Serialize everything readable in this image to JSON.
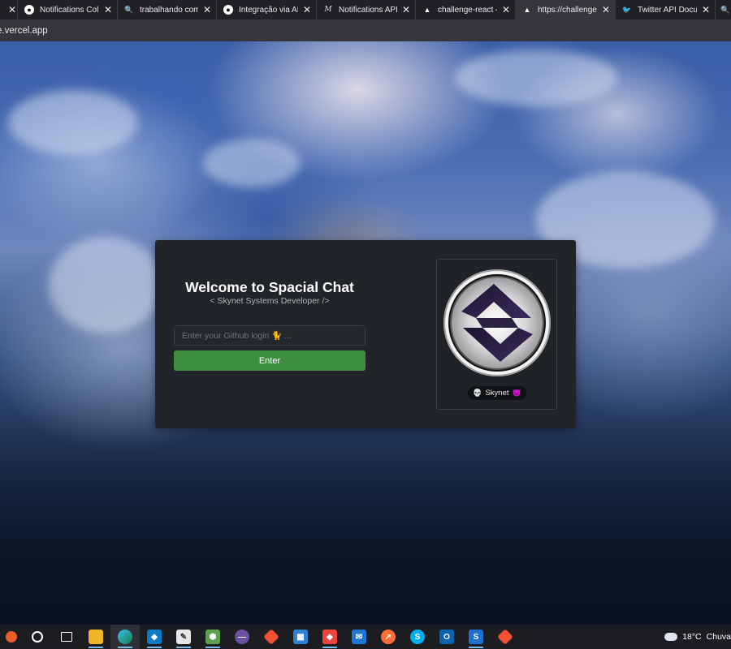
{
  "browser": {
    "tabs": [
      {
        "title": "Notifications Colle",
        "icon": "github-icon"
      },
      {
        "title": "trabalhando com A",
        "icon": "search-icon"
      },
      {
        "title": "Integração via API",
        "icon": "github-icon"
      },
      {
        "title": "Notifications API -",
        "icon": "medium-icon"
      },
      {
        "title": "challenge-react – C",
        "icon": "vercel-icon"
      },
      {
        "title": "https://challenge-r",
        "icon": "vercel-icon",
        "active": true
      },
      {
        "title": "Twitter API Docum",
        "icon": "twitter-icon"
      }
    ],
    "url": "e.vercel.app"
  },
  "login": {
    "title": "Welcome to Spacial Chat",
    "subtitle": "< Skynet Systems Developer />",
    "input_placeholder": "Enter your Github login 🐈 ...",
    "enter_label": "Enter"
  },
  "profile": {
    "name": "Skynet",
    "left_icon": "💀",
    "right_icon": "😈"
  },
  "taskbar": {
    "weather": "18°C",
    "weather_text": "Chuva"
  },
  "colors": {
    "accent_green": "#3e8e41",
    "card_bg": "#212529"
  }
}
